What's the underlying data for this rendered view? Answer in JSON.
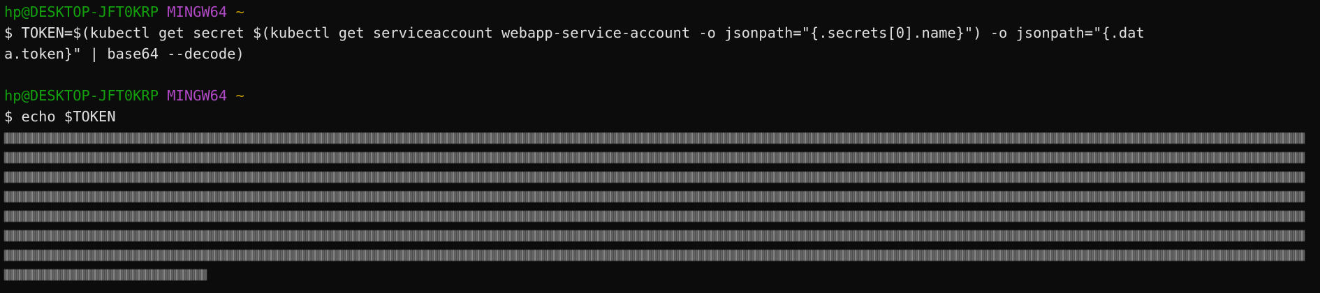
{
  "prompt1": {
    "user": "hp@DESKTOP-JFT0KRP",
    "env": "MINGW64",
    "dir": "~"
  },
  "command1": {
    "line1": "$ TOKEN=$(kubectl get secret $(kubectl get serviceaccount webapp-service-account -o jsonpath=\"{.secrets[0].name}\") -o jsonpath=\"{.dat",
    "line2": "a.token}\" | base64 --decode)"
  },
  "prompt2": {
    "user": "hp@DESKTOP-JFT0KRP",
    "env": "MINGW64",
    "dir": "~"
  },
  "command2": {
    "line1": "$ echo $TOKEN"
  },
  "output": {
    "redacted": true,
    "row_count": 7
  }
}
